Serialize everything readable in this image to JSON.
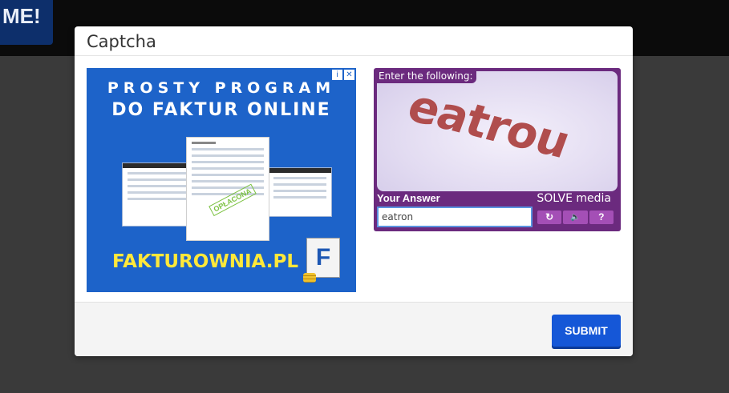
{
  "background": {
    "logo_fragment": "ME!"
  },
  "modal": {
    "title": "Captcha",
    "submit_label": "SUBMIT"
  },
  "ad": {
    "line1": "PROSTY PROGRAM",
    "line2": "DO FAKTUR ONLINE",
    "stamp": "OPŁACONA",
    "domain": "FAKTUROWNIA.PL",
    "icon_letter": "F",
    "badge_info": "i",
    "badge_close": "✕"
  },
  "captcha": {
    "prompt": "Enter the following:",
    "challenge_word": "eatrou",
    "answer_label": "Your Answer",
    "brand": "SOLVE media",
    "answer_value": "eatron",
    "buttons": {
      "refresh": "↻",
      "audio": "🔈",
      "help": "?"
    }
  },
  "colors": {
    "modal_bg": "#ffffff",
    "submit": "#1557d7",
    "captcha_purple": "#6b2a7e",
    "ad_blue": "#1d63c9"
  }
}
